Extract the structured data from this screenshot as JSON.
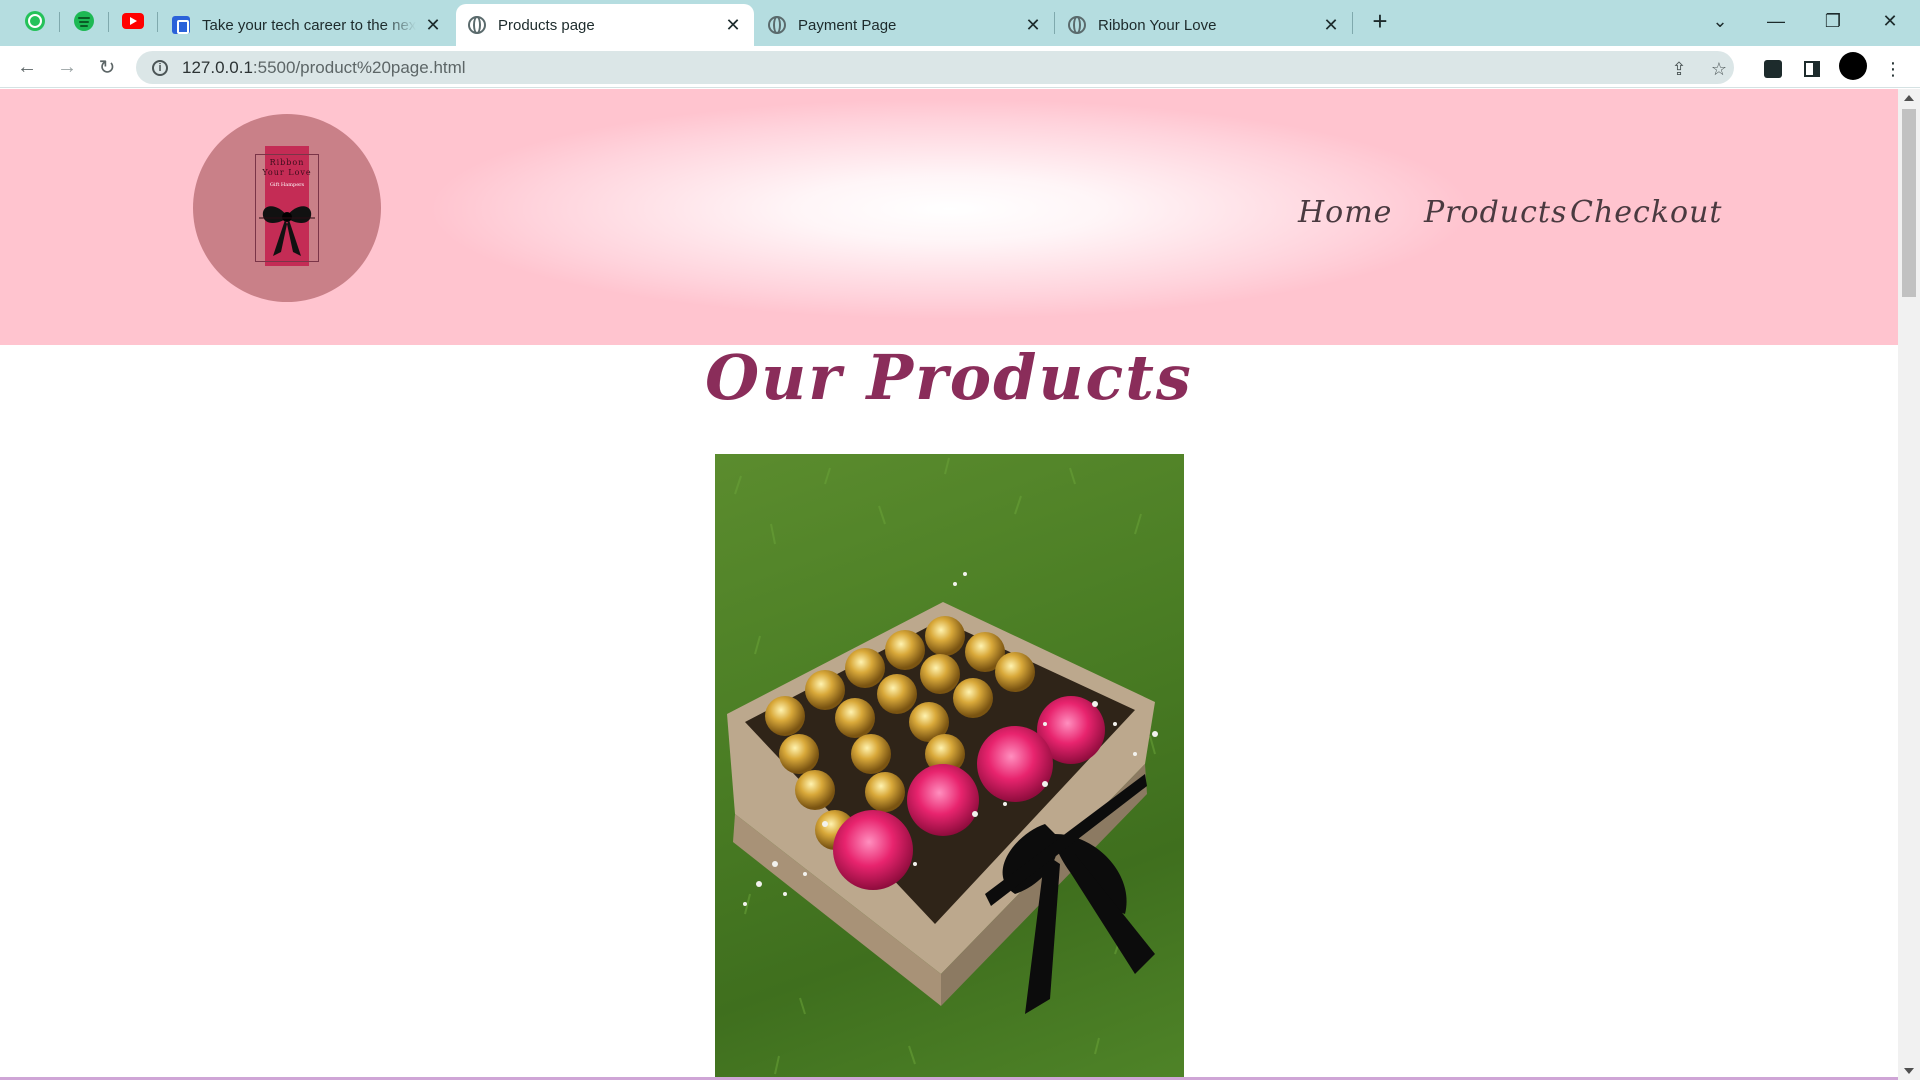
{
  "browser": {
    "pinned_tabs": [
      {
        "name": "whatsapp-icon"
      },
      {
        "name": "spotify-icon"
      },
      {
        "name": "youtube-icon"
      }
    ],
    "tabs": [
      {
        "title": "Take your tech career to the next",
        "active": false
      },
      {
        "title": "Products page",
        "active": true
      },
      {
        "title": "Payment Page",
        "active": false
      },
      {
        "title": "Ribbon Your Love",
        "active": false
      }
    ],
    "address": {
      "host": "127.0.0.1",
      "path": ":5500/product%20page.html"
    },
    "colors": {
      "tabstrip": "#b5dde0",
      "omnibox": "#dbe6e7"
    }
  },
  "site": {
    "logo": {
      "line1": "Ribbon",
      "line2": "Your Love",
      "line3": "Gift Hampers"
    },
    "nav": [
      "Home",
      "Products",
      "Checkout"
    ],
    "heading": "Our Products",
    "colors": {
      "header_pink": "#ffc4cf",
      "heading": "#8a2d5a",
      "logo_bg": "#c98088"
    }
  }
}
